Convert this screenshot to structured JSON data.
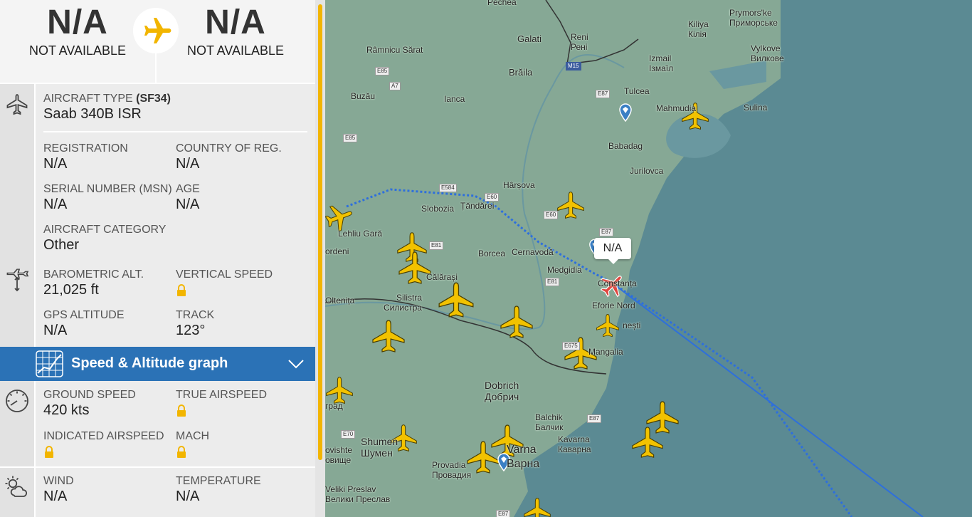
{
  "route": {
    "origin": {
      "code": "N/A",
      "name": "NOT AVAILABLE"
    },
    "destination": {
      "code": "N/A",
      "name": "NOT AVAILABLE"
    }
  },
  "aircraft": {
    "type_label": "AIRCRAFT TYPE",
    "type_code": "(SF34)",
    "type_value": "Saab 340B ISR",
    "registration_label": "REGISTRATION",
    "registration_value": "N/A",
    "country_label": "COUNTRY OF REG.",
    "country_value": "N/A",
    "msn_label": "SERIAL NUMBER (MSN)",
    "msn_value": "N/A",
    "age_label": "AGE",
    "age_value": "N/A",
    "category_label": "AIRCRAFT CATEGORY",
    "category_value": "Other"
  },
  "altitude": {
    "baro_label": "BAROMETRIC ALT.",
    "baro_value": "21,025 ft",
    "vs_label": "VERTICAL SPEED",
    "gps_label": "GPS ALTITUDE",
    "gps_value": "N/A",
    "track_label": "TRACK",
    "track_value": "123°"
  },
  "graph": {
    "label": "Speed & Altitude graph"
  },
  "speed": {
    "gs_label": "GROUND SPEED",
    "gs_value": "420 kts",
    "tas_label": "TRUE AIRSPEED",
    "ias_label": "INDICATED AIRSPEED",
    "mach_label": "MACH"
  },
  "weather": {
    "wind_label": "WIND",
    "wind_value": "N/A",
    "temp_label": "TEMPERATURE",
    "temp_value": "N/A"
  },
  "colors": {
    "accent_yellow": "#f2b500",
    "graph_bar_blue": "#2b72b6",
    "selected_plane_red": "#e0463f",
    "track_blue": "#2e6fdc",
    "sea": "#5b8a93",
    "land": "#86a895"
  },
  "map": {
    "callout": "N/A",
    "labels": {
      "pechea": "Pechea",
      "galati": "Galati",
      "reni": "Reni",
      "reni_cyr": "Рені",
      "rimnicu": "Râmnicu Sărat",
      "kiliya": "Kiliya",
      "kiliya_cyr": "Кілія",
      "prymorske": "Prymors'ke",
      "prymorske_cyr": "Приморське",
      "izmail": "Izmail",
      "izmail_cyr": "Ізмаїл",
      "vylkove": "Vylkove",
      "vylkove_cyr": "Вилкове",
      "braila": "Brăila",
      "buzau": "Buzău",
      "ianca": "Ianca",
      "tulcea": "Tulcea",
      "mahmudia": "Mahmudia",
      "sulina": "Sulina",
      "babadag": "Babadag",
      "jurilovca": "Jurilovca",
      "harsova": "Hârșova",
      "slobozia": "Slobozia",
      "tandarei": "Țăndărei",
      "lehliu": "Lehliu Gară",
      "ordeni": "ordeni",
      "borcea": "Borcea",
      "cernavoda": "Cernavodă",
      "calarasi": "Călărași",
      "medgidia": "Medgidia",
      "constanta": "Constanța",
      "oltenita": "Oltenița",
      "silistra": "Silistra",
      "silistra_cyr": "Силистра",
      "eforie": "Eforie Nord",
      "tuzla": "Tuzla",
      "neasti": "nești",
      "mangalia": "Mangalia",
      "dobrich": "Dobrich",
      "dobrich_cyr": "Добрич",
      "grad": "град",
      "balchik": "Balchik",
      "balchik_cyr": "Балчик",
      "kavarna": "Kavarna",
      "kavarna_cyr": "Каварна",
      "shumen": "Shumen",
      "shumen_cyr": "Шумен",
      "novi": "ovishte",
      "novi_cyr": "овище",
      "varna": "Varna",
      "varna_cyr": "Варна",
      "provadia": "Provadia",
      "provadia_cyr": "Провадия",
      "preslav": "Veliki Preslav",
      "preslav_cyr": "Велики Преслав"
    },
    "roads": {
      "m15": "M15",
      "e87a": "E87",
      "e87b": "E87",
      "e87c": "E87",
      "e87d": "E87",
      "e85a": "E85",
      "e85b": "E85",
      "a7": "A7",
      "e584": "E584",
      "e60a": "E60",
      "e60b": "E60",
      "e81a": "E81",
      "e81b": "E81",
      "e675": "E675",
      "e70": "E70",
      "e87e": "E87"
    }
  }
}
